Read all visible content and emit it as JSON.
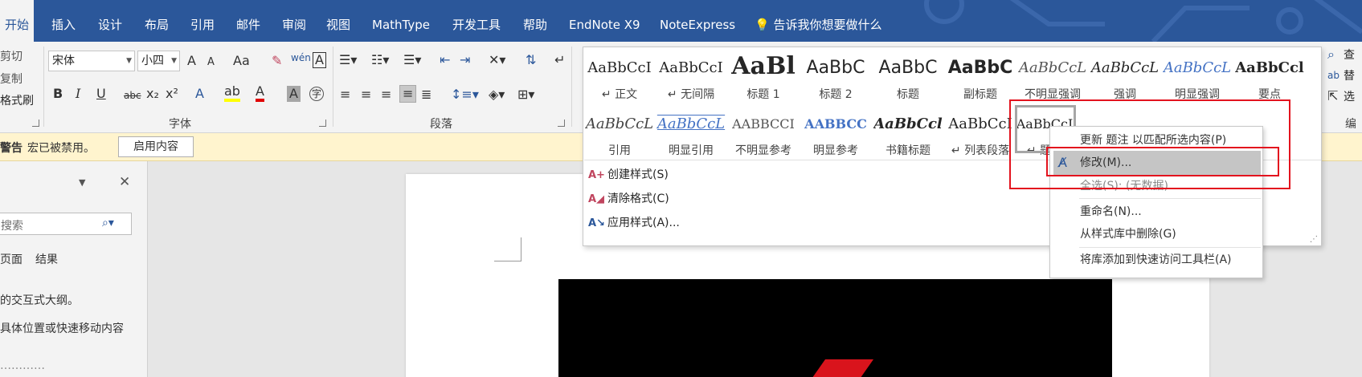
{
  "tabs": [
    "开始",
    "插入",
    "设计",
    "布局",
    "引用",
    "邮件",
    "审阅",
    "视图",
    "MathType",
    "开发工具",
    "帮助",
    "EndNote X9",
    "NoteExpress"
  ],
  "tell_me": "告诉我你想要做什么",
  "clipboard": {
    "cut": "剪切",
    "copy": "复制",
    "format_painter": "格式刷"
  },
  "font": {
    "name": "宋体",
    "size": "小四",
    "group_label": "字体",
    "grow": "A",
    "shrink": "A",
    "case": "Aa",
    "phonetic": "wén",
    "border_char": "A",
    "bold": "B",
    "italic": "I",
    "underline": "U",
    "strike": "abc",
    "sub": "x₂",
    "sup": "x²",
    "effects": "A",
    "highlight": "ab",
    "font_color": "A",
    "shading": "A",
    "enclose": "字"
  },
  "paragraph": {
    "group_label": "段落"
  },
  "editing": {
    "find": "查",
    "replace": "替",
    "select": "选",
    "group_label": "编"
  },
  "styles": [
    {
      "sample": "AaBbCcI",
      "name": "↵ 正文"
    },
    {
      "sample": "AaBbCcI",
      "name": "↵ 无间隔"
    },
    {
      "sample": "AaBl",
      "name": "标题 1"
    },
    {
      "sample": "AaBbC",
      "name": "标题 2"
    },
    {
      "sample": "AaBbC",
      "name": "标题"
    },
    {
      "sample": "AaBbC",
      "name": "副标题"
    },
    {
      "sample": "AaBbCcL",
      "name": "不明显强调"
    },
    {
      "sample": "AaBbCcL",
      "name": "强调"
    },
    {
      "sample": "AaBbCcL",
      "name": "明显强调"
    },
    {
      "sample": "AaBbCcl",
      "name": "要点"
    },
    {
      "sample": "AaBbCcL",
      "name": "引用"
    },
    {
      "sample": "AaBbCcL",
      "name": "明显引用"
    },
    {
      "sample": "AABBCCI",
      "name": "不明显参考"
    },
    {
      "sample": "AABBCC",
      "name": "明显参考"
    },
    {
      "sample": "AaBbCcl",
      "name": "书籍标题"
    },
    {
      "sample": "AaBbCcI",
      "name": "↵ 列表段落"
    },
    {
      "sample": "AaBbCcI",
      "name": "↵ 题注"
    }
  ],
  "gallery_commands": [
    "创建样式(S)",
    "清除格式(C)",
    "应用样式(A)..."
  ],
  "context_menu": [
    {
      "label": "更新 题注 以匹配所选内容(P)"
    },
    {
      "label": "修改(M)..."
    },
    {
      "label": "全选(S): (无数据)"
    },
    {
      "label": "重命名(N)..."
    },
    {
      "label": "从样式库中删除(G)"
    },
    {
      "label": "将库添加到快速访问工具栏(A)"
    }
  ],
  "warning": {
    "title": "警告",
    "message": "宏已被禁用。",
    "button": "启用内容"
  },
  "nav": {
    "search_placeholder": "搜索",
    "tab_pages": "页面",
    "tab_results": "结果",
    "line1": "的交互式大纲。",
    "line2": "具体位置或快速移动内容",
    "line3": "…………"
  },
  "colors": {
    "ribbon_blue": "#2b579a",
    "annotation_red": "#e3131e",
    "warning_bg": "#fff4ce"
  }
}
